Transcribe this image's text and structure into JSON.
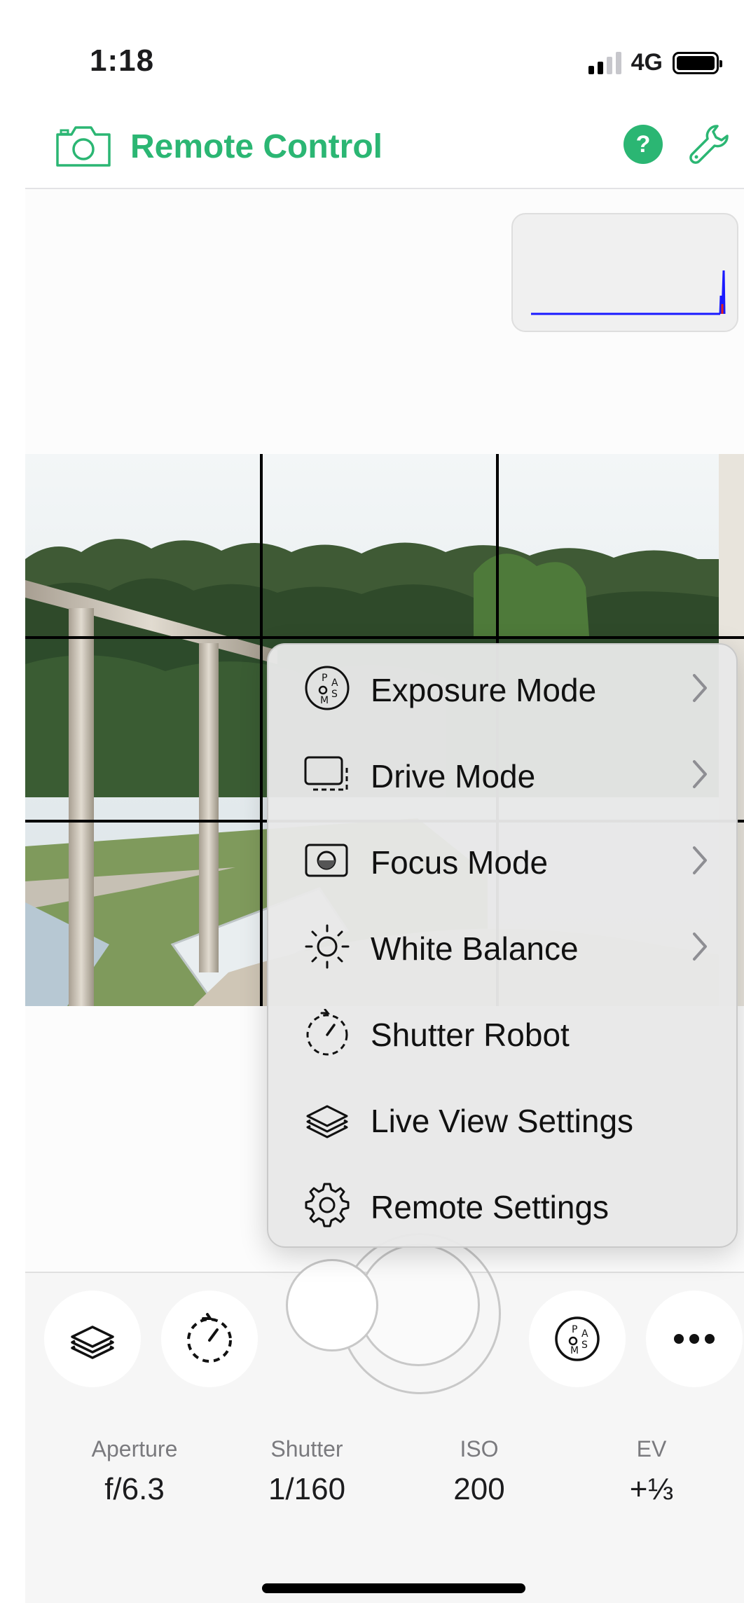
{
  "status_bar": {
    "time": "1:18",
    "network": "4G"
  },
  "header": {
    "title": "Remote Control",
    "help_label": "?"
  },
  "menu": {
    "items": [
      {
        "label": "Exposure Mode",
        "icon": "exposure-mode-dial-icon",
        "has_submenu": true
      },
      {
        "label": "Drive Mode",
        "icon": "drive-mode-icon",
        "has_submenu": true
      },
      {
        "label": "Focus Mode",
        "icon": "focus-mode-icon",
        "has_submenu": true
      },
      {
        "label": "White Balance",
        "icon": "sun-icon",
        "has_submenu": true
      },
      {
        "label": "Shutter Robot",
        "icon": "timer-icon",
        "has_submenu": false
      },
      {
        "label": "Live View Settings",
        "icon": "layers-icon",
        "has_submenu": false
      },
      {
        "label": "Remote Settings",
        "icon": "gear-icon",
        "has_submenu": false
      }
    ]
  },
  "settings": [
    {
      "label": "Aperture",
      "value": "f/6.3"
    },
    {
      "label": "Shutter",
      "value": "1/160"
    },
    {
      "label": "ISO",
      "value": "200"
    },
    {
      "label": "EV",
      "value": "+⅓"
    }
  ],
  "colors": {
    "accent": "#2bb673",
    "histogram_line": "#1a1aff"
  }
}
